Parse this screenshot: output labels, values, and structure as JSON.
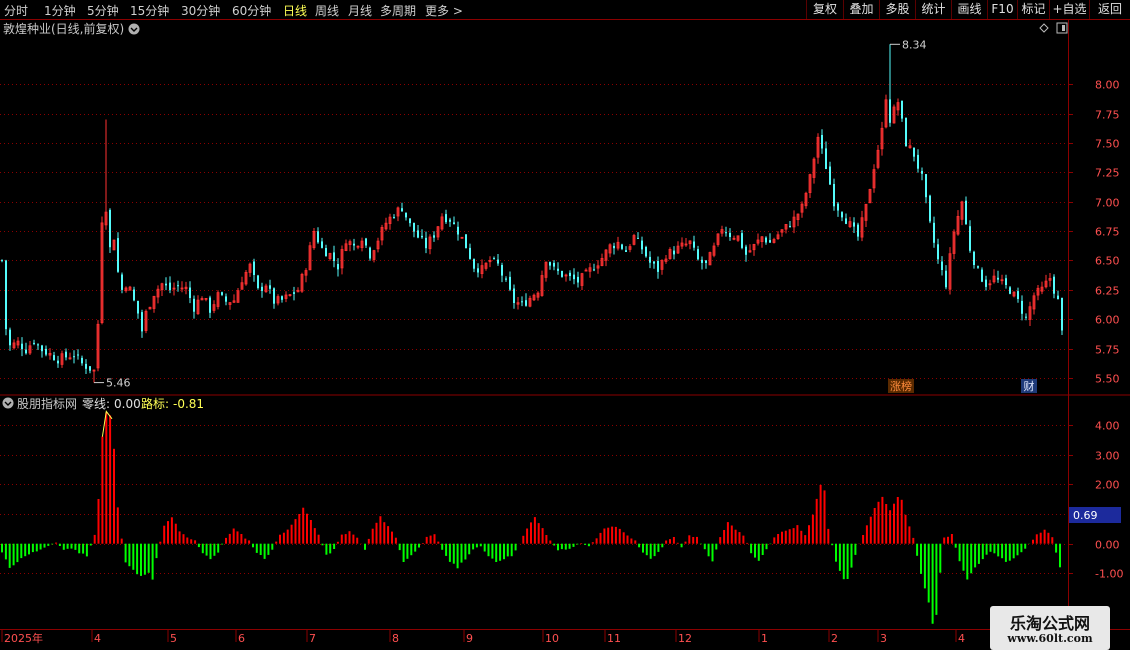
{
  "toolbar": {
    "timeframes": [
      "分时",
      "1分钟",
      "5分钟",
      "15分钟",
      "30分钟",
      "60分钟",
      "日线",
      "周线",
      "月线",
      "多周期",
      "更多 >"
    ],
    "active_timeframe": "日线",
    "buttons": [
      "复权",
      "叠加",
      "多股",
      "统计",
      "画线",
      "F10",
      "标记",
      "+自选",
      "返回"
    ]
  },
  "price_panel": {
    "title": "敦煌种业(日线,前复权)",
    "badge_zhangbang": "涨榜",
    "badge_cai": "财"
  },
  "indicator_panel": {
    "name": "股朋指标网",
    "zero_label": "零线:",
    "zero_value": "0.00",
    "road_label": "路标:",
    "road_value": "-0.81",
    "current_value_box": "0.69"
  },
  "logo": {
    "line1": "乐淘公式网",
    "line2": "www.60lt.com"
  },
  "colors": {
    "up": "#ff3232",
    "down": "#54fcfc",
    "macd_up": "#ff0000",
    "macd_down": "#00ff00",
    "grid": "#8b0000",
    "axis_text": "#ff5050",
    "title_text": "#c8c8c8",
    "active_tab": "#ffff54"
  },
  "chart_data": [
    {
      "type": "candlestick",
      "title": "敦煌种业(日线,前复权)",
      "y_ticks": [
        "8.00",
        "7.75",
        "7.50",
        "7.25",
        "7.00",
        "6.75",
        "6.50",
        "6.25",
        "6.00",
        "5.75",
        "5.50"
      ],
      "ylim": [
        5.38,
        8.53
      ],
      "annotations": [
        {
          "label": "8.34",
          "value": 8.34
        },
        {
          "label": "5.46",
          "value": 5.46
        }
      ],
      "close_path": [
        [
          0,
          6.5
        ],
        [
          1,
          5.92
        ],
        [
          2,
          5.77
        ],
        [
          4,
          5.8
        ],
        [
          6,
          5.74
        ],
        [
          8,
          5.82
        ],
        [
          10,
          5.74
        ],
        [
          12,
          5.7
        ],
        [
          14,
          5.66
        ],
        [
          16,
          5.68
        ],
        [
          18,
          5.7
        ],
        [
          20,
          5.62
        ],
        [
          22,
          5.58
        ],
        [
          23,
          5.56
        ],
        [
          24,
          5.96
        ],
        [
          25,
          6.85
        ],
        [
          26,
          6.95
        ],
        [
          27,
          6.6
        ],
        [
          28,
          6.7
        ],
        [
          29,
          6.4
        ],
        [
          30,
          6.25
        ],
        [
          31,
          6.3
        ],
        [
          32,
          6.25
        ],
        [
          33,
          6.15
        ],
        [
          34,
          6.05
        ],
        [
          35,
          5.9
        ],
        [
          36,
          6.05
        ],
        [
          38,
          6.22
        ],
        [
          40,
          6.3
        ],
        [
          42,
          6.25
        ],
        [
          44,
          6.28
        ],
        [
          46,
          6.26
        ],
        [
          48,
          6.1
        ],
        [
          50,
          6.2
        ],
        [
          52,
          6.08
        ],
        [
          54,
          6.2
        ],
        [
          56,
          6.15
        ],
        [
          58,
          6.16
        ],
        [
          60,
          6.34
        ],
        [
          62,
          6.45
        ],
        [
          64,
          6.24
        ],
        [
          66,
          6.3
        ],
        [
          68,
          6.15
        ],
        [
          70,
          6.16
        ],
        [
          72,
          6.2
        ],
        [
          74,
          6.25
        ],
        [
          76,
          6.45
        ],
        [
          78,
          6.75
        ],
        [
          80,
          6.6
        ],
        [
          82,
          6.55
        ],
        [
          84,
          6.45
        ],
        [
          86,
          6.68
        ],
        [
          88,
          6.62
        ],
        [
          90,
          6.7
        ],
        [
          92,
          6.55
        ],
        [
          94,
          6.68
        ],
        [
          96,
          6.82
        ],
        [
          98,
          6.9
        ],
        [
          100,
          6.95
        ],
        [
          102,
          6.8
        ],
        [
          104,
          6.7
        ],
        [
          106,
          6.62
        ],
        [
          108,
          6.72
        ],
        [
          110,
          6.88
        ],
        [
          112,
          6.85
        ],
        [
          114,
          6.75
        ],
        [
          116,
          6.62
        ],
        [
          118,
          6.45
        ],
        [
          120,
          6.42
        ],
        [
          122,
          6.5
        ],
        [
          124,
          6.46
        ],
        [
          126,
          6.3
        ],
        [
          128,
          6.15
        ],
        [
          130,
          6.12
        ],
        [
          132,
          6.18
        ],
        [
          134,
          6.25
        ],
        [
          136,
          6.52
        ],
        [
          138,
          6.42
        ],
        [
          140,
          6.38
        ],
        [
          142,
          6.35
        ],
        [
          144,
          6.32
        ],
        [
          146,
          6.38
        ],
        [
          148,
          6.45
        ],
        [
          150,
          6.52
        ],
        [
          152,
          6.62
        ],
        [
          154,
          6.65
        ],
        [
          156,
          6.58
        ],
        [
          158,
          6.7
        ],
        [
          160,
          6.6
        ],
        [
          162,
          6.48
        ],
        [
          164,
          6.42
        ],
        [
          166,
          6.55
        ],
        [
          168,
          6.58
        ],
        [
          170,
          6.62
        ],
        [
          172,
          6.65
        ],
        [
          174,
          6.5
        ],
        [
          176,
          6.46
        ],
        [
          178,
          6.6
        ],
        [
          180,
          6.78
        ],
        [
          182,
          6.72
        ],
        [
          184,
          6.7
        ],
        [
          186,
          6.55
        ],
        [
          188,
          6.62
        ],
        [
          190,
          6.7
        ],
        [
          192,
          6.65
        ],
        [
          194,
          6.72
        ],
        [
          196,
          6.78
        ],
        [
          198,
          6.85
        ],
        [
          200,
          6.95
        ],
        [
          202,
          7.2
        ],
        [
          204,
          7.55
        ],
        [
          206,
          7.3
        ],
        [
          208,
          7.0
        ],
        [
          210,
          6.9
        ],
        [
          212,
          6.8
        ],
        [
          214,
          6.7
        ],
        [
          216,
          6.95
        ],
        [
          218,
          7.3
        ],
        [
          220,
          7.6
        ],
        [
          221,
          7.9
        ],
        [
          222,
          7.7
        ],
        [
          224,
          7.85
        ],
        [
          226,
          7.5
        ],
        [
          228,
          7.4
        ],
        [
          230,
          7.2
        ],
        [
          232,
          6.8
        ],
        [
          234,
          6.5
        ],
        [
          236,
          6.3
        ],
        [
          238,
          6.75
        ],
        [
          240,
          7.0
        ],
        [
          242,
          6.6
        ],
        [
          244,
          6.4
        ],
        [
          246,
          6.3
        ],
        [
          248,
          6.35
        ],
        [
          250,
          6.3
        ],
        [
          252,
          6.25
        ],
        [
          254,
          6.15
        ],
        [
          256,
          6.0
        ],
        [
          258,
          6.2
        ],
        [
          260,
          6.25
        ],
        [
          262,
          6.35
        ],
        [
          264,
          6.15
        ],
        [
          265,
          5.88
        ]
      ]
    },
    {
      "type": "bar",
      "title": "股朋指标网",
      "y_ticks": [
        "4.00",
        "3.00",
        "2.00",
        "1.00",
        "0.00",
        "-1.00"
      ],
      "ylim": [
        -2.8,
        4.9
      ],
      "x_labels": [
        "2025年",
        "4",
        "5",
        "6",
        "7",
        "8",
        "9",
        "10",
        "11",
        "12",
        "1",
        "2",
        "3",
        "4"
      ],
      "series_path": [
        [
          0,
          -0.3
        ],
        [
          2,
          -0.8
        ],
        [
          4,
          -0.6
        ],
        [
          6,
          -0.4
        ],
        [
          8,
          -0.3
        ],
        [
          10,
          -0.2
        ],
        [
          12,
          -0.1
        ],
        [
          14,
          0.05
        ],
        [
          16,
          -0.2
        ],
        [
          18,
          -0.15
        ],
        [
          20,
          -0.3
        ],
        [
          22,
          -0.4
        ],
        [
          24,
          0.3
        ],
        [
          25,
          1.5
        ],
        [
          26,
          3.6
        ],
        [
          27,
          4.4
        ],
        [
          28,
          4.3
        ],
        [
          29,
          3.2
        ],
        [
          30,
          1.2
        ],
        [
          31,
          0.2
        ],
        [
          32,
          -0.6
        ],
        [
          34,
          -0.9
        ],
        [
          36,
          -1.1
        ],
        [
          38,
          -1.0
        ],
        [
          39,
          -1.2
        ],
        [
          40,
          -0.5
        ],
        [
          42,
          0.6
        ],
        [
          44,
          0.9
        ],
        [
          46,
          0.4
        ],
        [
          48,
          0.2
        ],
        [
          50,
          0.1
        ],
        [
          52,
          -0.3
        ],
        [
          54,
          -0.5
        ],
        [
          56,
          -0.3
        ],
        [
          58,
          0.2
        ],
        [
          60,
          0.5
        ],
        [
          62,
          0.3
        ],
        [
          64,
          0.1
        ],
        [
          66,
          -0.3
        ],
        [
          68,
          -0.5
        ],
        [
          70,
          -0.2
        ],
        [
          72,
          0.3
        ],
        [
          74,
          0.5
        ],
        [
          76,
          0.8
        ],
        [
          78,
          1.2
        ],
        [
          80,
          0.8
        ],
        [
          82,
          0.3
        ],
        [
          84,
          -0.4
        ],
        [
          86,
          -0.2
        ],
        [
          88,
          0.3
        ],
        [
          90,
          0.4
        ],
        [
          92,
          0.2
        ],
        [
          94,
          -0.2
        ],
        [
          96,
          0.5
        ],
        [
          98,
          0.9
        ],
        [
          100,
          0.6
        ],
        [
          102,
          0.2
        ],
        [
          104,
          -0.6
        ],
        [
          106,
          -0.4
        ],
        [
          108,
          -0.1
        ],
        [
          110,
          0.2
        ],
        [
          112,
          0.3
        ],
        [
          114,
          -0.2
        ],
        [
          116,
          -0.6
        ],
        [
          118,
          -0.8
        ],
        [
          120,
          -0.5
        ],
        [
          122,
          -0.2
        ],
        [
          124,
          -0.1
        ],
        [
          126,
          -0.4
        ],
        [
          128,
          -0.6
        ],
        [
          130,
          -0.5
        ],
        [
          132,
          -0.4
        ],
        [
          134,
          0.0
        ],
        [
          136,
          0.5
        ],
        [
          138,
          0.9
        ],
        [
          140,
          0.5
        ],
        [
          142,
          0.1
        ],
        [
          144,
          -0.2
        ],
        [
          146,
          -0.2
        ],
        [
          148,
          -0.1
        ],
        [
          150,
          0.0
        ],
        [
          152,
          -0.1
        ],
        [
          154,
          0.2
        ],
        [
          156,
          0.5
        ],
        [
          158,
          0.6
        ],
        [
          160,
          0.5
        ],
        [
          162,
          0.3
        ],
        [
          164,
          0.1
        ],
        [
          166,
          -0.3
        ],
        [
          168,
          -0.5
        ],
        [
          170,
          -0.3
        ],
        [
          172,
          0.1
        ],
        [
          174,
          0.2
        ],
        [
          176,
          -0.1
        ],
        [
          178,
          0.3
        ],
        [
          180,
          0.2
        ],
        [
          182,
          -0.2
        ],
        [
          184,
          -0.6
        ],
        [
          186,
          0.2
        ],
        [
          188,
          0.7
        ],
        [
          190,
          0.5
        ],
        [
          192,
          0.3
        ],
        [
          194,
          -0.3
        ],
        [
          196,
          -0.6
        ],
        [
          198,
          -0.2
        ],
        [
          200,
          0.2
        ],
        [
          202,
          0.4
        ],
        [
          204,
          0.5
        ],
        [
          206,
          0.6
        ],
        [
          208,
          0.3
        ],
        [
          210,
          1.0
        ],
        [
          212,
          2.0
        ],
        [
          213,
          1.8
        ],
        [
          214,
          0.5
        ],
        [
          216,
          -0.6
        ],
        [
          218,
          -1.2
        ],
        [
          219,
          -1.2
        ],
        [
          220,
          -0.8
        ],
        [
          222,
          0.0
        ],
        [
          224,
          0.6
        ],
        [
          226,
          1.2
        ],
        [
          228,
          1.6
        ],
        [
          230,
          1.1
        ],
        [
          232,
          1.6
        ],
        [
          233,
          1.5
        ],
        [
          234,
          1.0
        ],
        [
          236,
          0.2
        ],
        [
          238,
          -1.0
        ],
        [
          240,
          -2.0
        ],
        [
          241,
          -2.7
        ],
        [
          242,
          -2.4
        ],
        [
          243,
          -1.0
        ],
        [
          244,
          0.2
        ],
        [
          246,
          0.3
        ],
        [
          248,
          -0.6
        ],
        [
          250,
          -1.2
        ],
        [
          252,
          -0.8
        ],
        [
          254,
          -0.5
        ],
        [
          256,
          -0.3
        ],
        [
          258,
          -0.4
        ],
        [
          260,
          -0.6
        ],
        [
          262,
          -0.5
        ],
        [
          264,
          -0.3
        ],
        [
          266,
          0.0
        ],
        [
          268,
          0.3
        ],
        [
          270,
          0.5
        ],
        [
          272,
          0.2
        ],
        [
          274,
          -0.8
        ]
      ]
    }
  ]
}
